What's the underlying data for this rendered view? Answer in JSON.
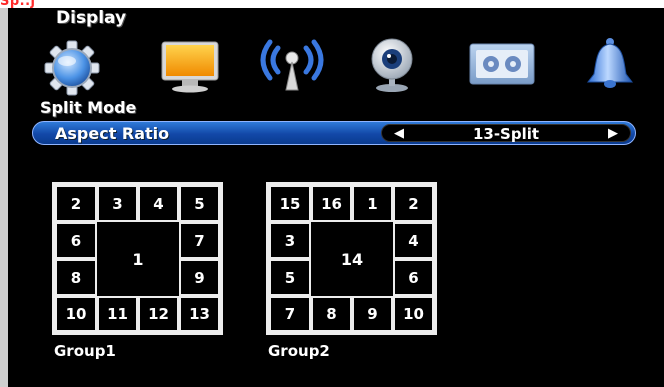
{
  "header": {
    "corner_text": "Sp..j",
    "title": "Display"
  },
  "icons": [
    "gear-icon",
    "monitor-icon",
    "wireless-icon",
    "camera-icon",
    "recorder-icon",
    "bell-icon"
  ],
  "split_mode": {
    "label": "Split Mode",
    "aspect_ratio_label": "Aspect Ratio",
    "value": "13-Split",
    "left_arrow": "◀",
    "right_arrow": "▶"
  },
  "groups": [
    {
      "label": "Group1",
      "large": "1",
      "cells": [
        "2",
        "3",
        "4",
        "5",
        "6",
        "7",
        "8",
        "9",
        "10",
        "11",
        "12",
        "13"
      ]
    },
    {
      "label": "Group2",
      "large": "14",
      "cells": [
        "15",
        "16",
        "1",
        "2",
        "3",
        "4",
        "5",
        "6",
        "7",
        "8",
        "9",
        "10"
      ]
    }
  ],
  "colors": {
    "highlight_bar": "#1248a8",
    "grid_border": "#ededed",
    "background": "#000000"
  }
}
